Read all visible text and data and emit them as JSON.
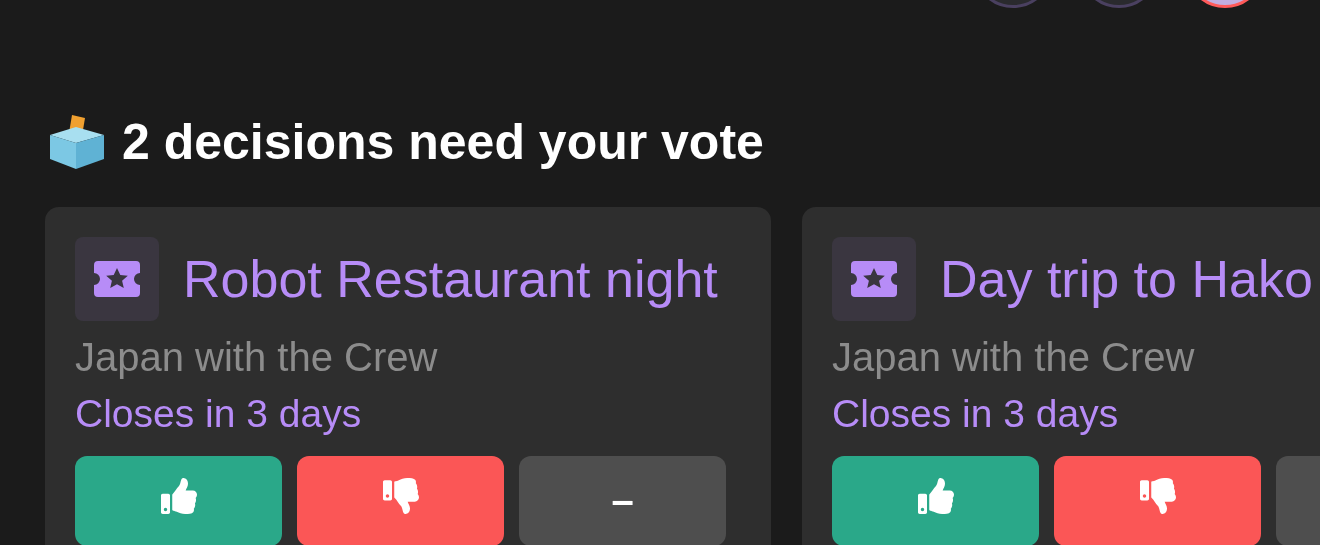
{
  "avatars": [
    {
      "kind": "member"
    },
    {
      "kind": "member"
    },
    {
      "kind": "me"
    }
  ],
  "heading": {
    "text": "2 decisions need your vote"
  },
  "decisions": [
    {
      "title": "Robot Restaurant night",
      "trip": "Japan with the Crew",
      "deadline": "Closes in 3 days",
      "buttons": [
        {
          "kind": "up"
        },
        {
          "kind": "down"
        },
        {
          "kind": "abstain",
          "label": "–"
        }
      ]
    },
    {
      "title": "Day trip to Hako",
      "trip": "Japan with the Crew",
      "deadline": "Closes in 3 days",
      "buttons": [
        {
          "kind": "up"
        },
        {
          "kind": "down"
        },
        {
          "kind": "abstain"
        }
      ]
    }
  ]
}
